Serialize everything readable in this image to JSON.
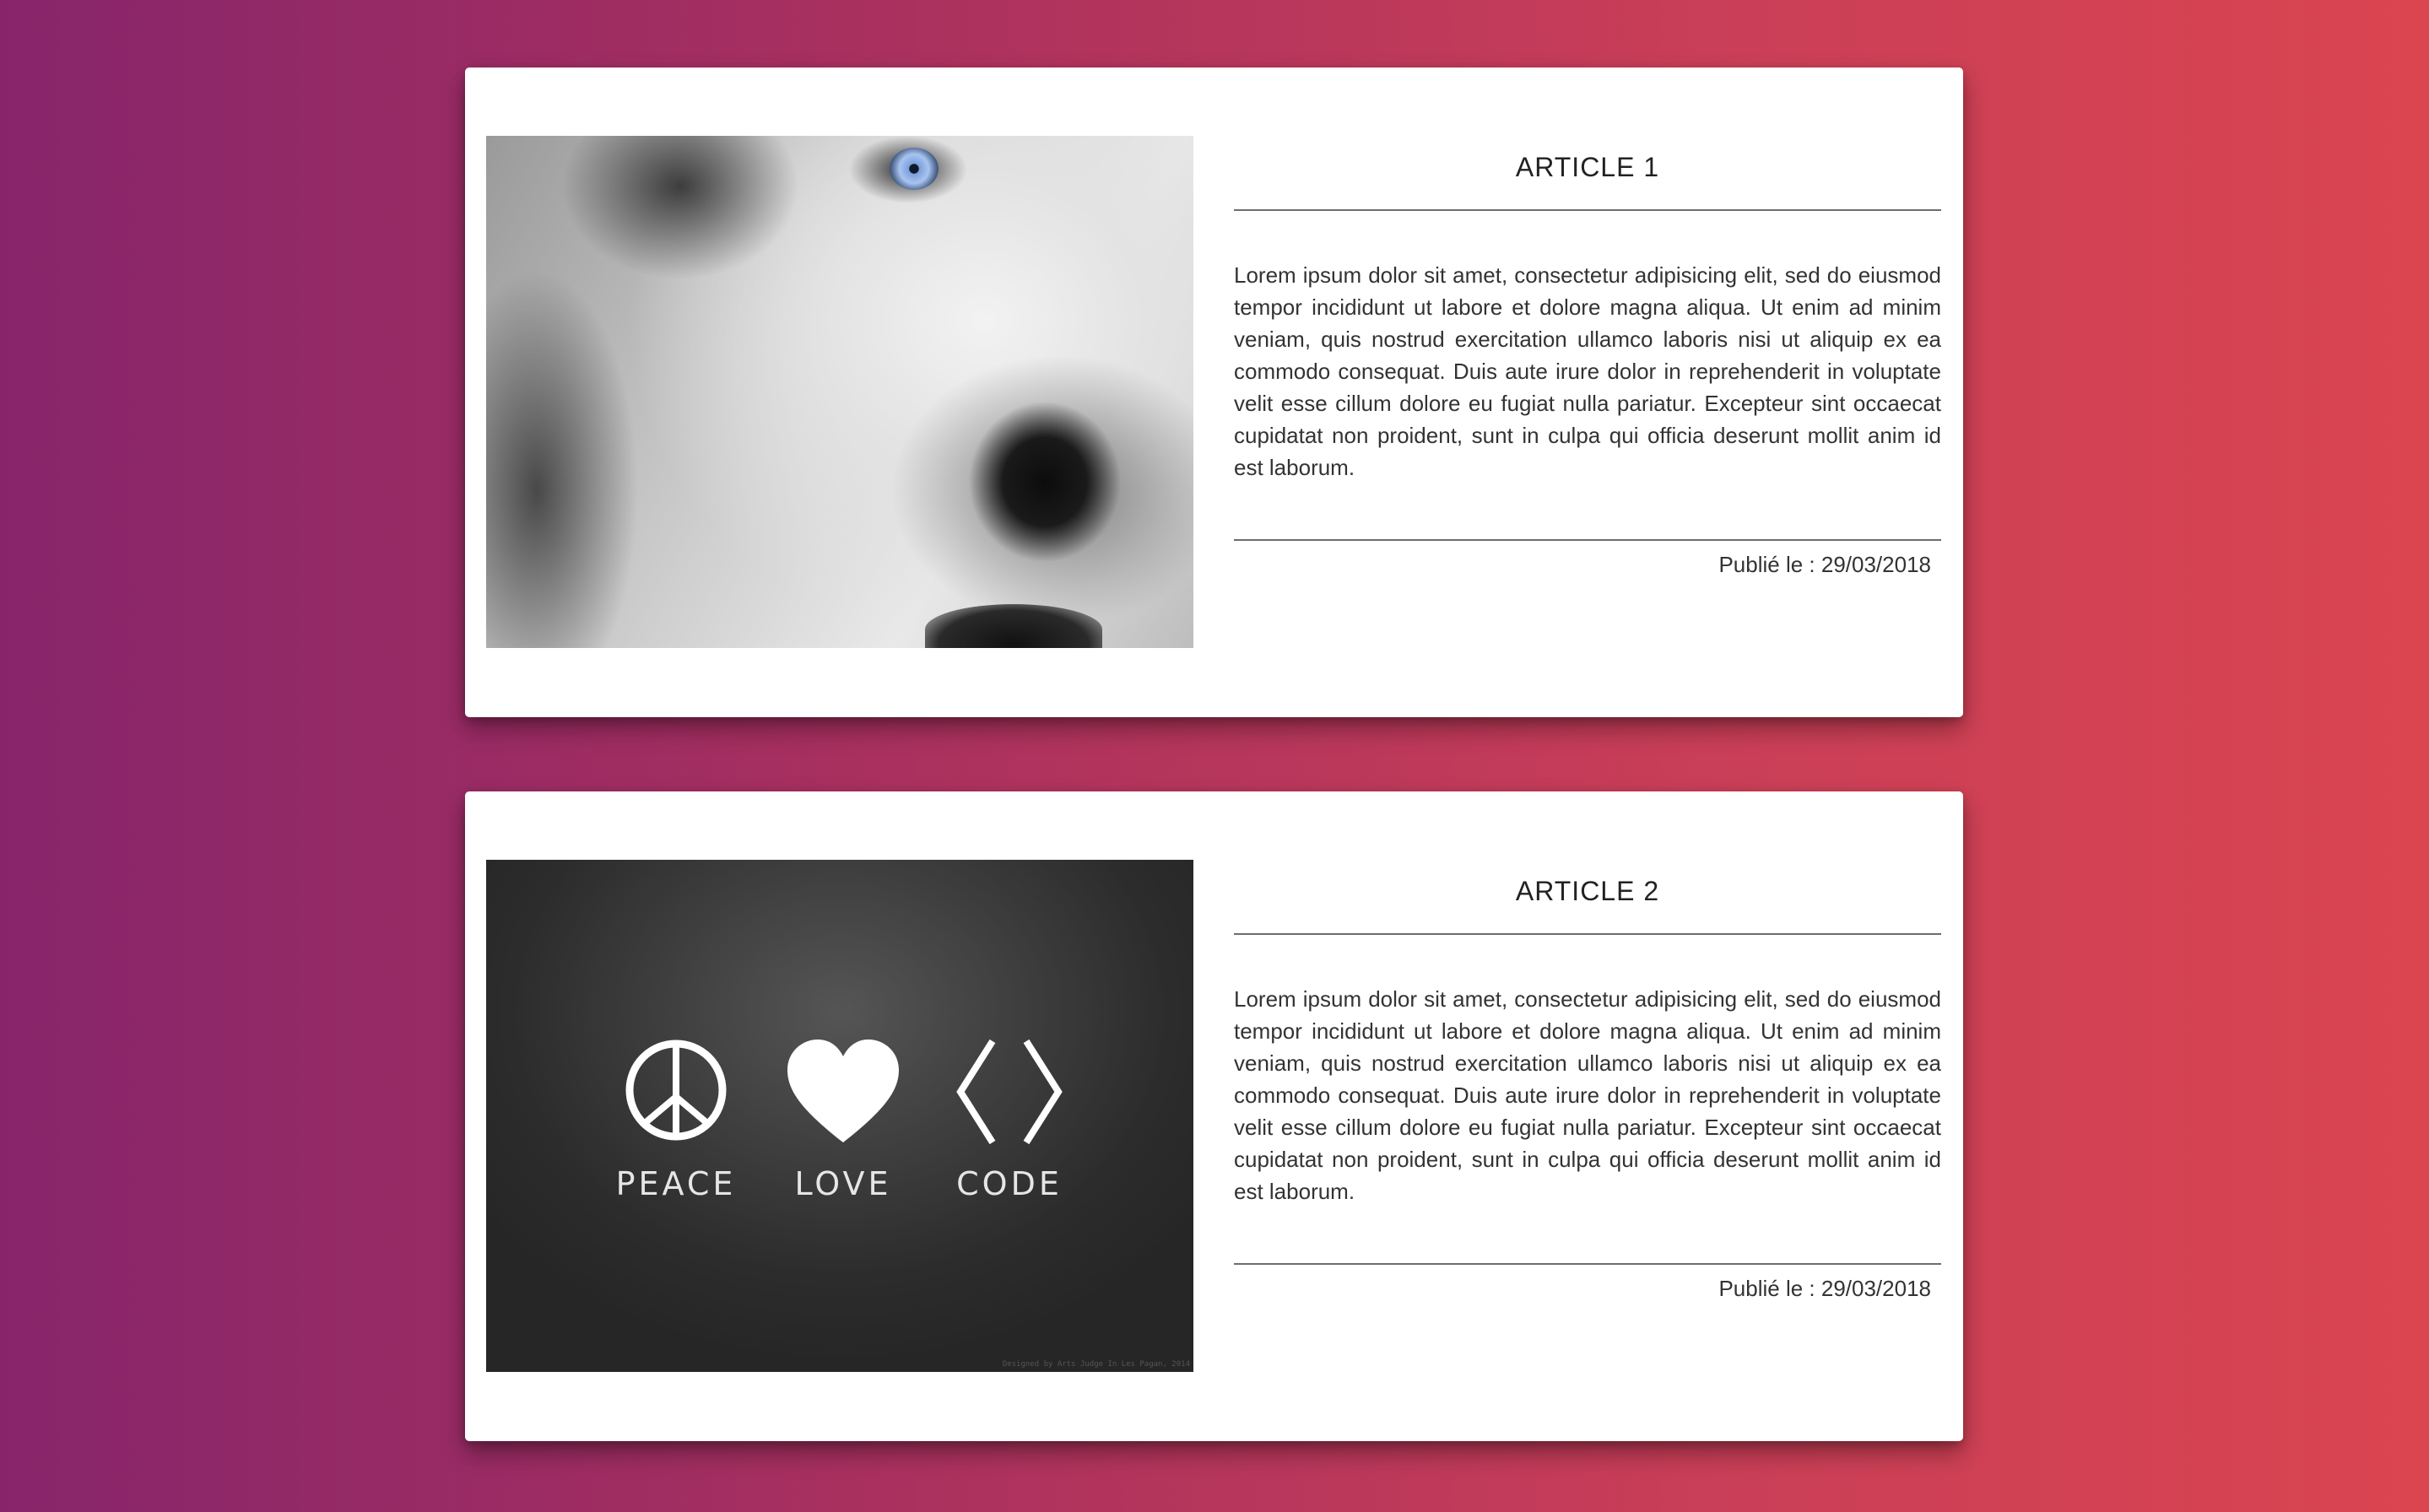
{
  "articles": [
    {
      "title": "ARTICLE 1",
      "image": "husky-wolf-closeup-photo",
      "body": "Lorem ipsum dolor sit amet, consectetur adipisicing elit, sed do eiusmod tempor incididunt ut labore et dolore magna aliqua. Ut enim ad minim veniam, quis nostrud exercitation ullamco laboris nisi ut aliquip ex ea commodo consequat. Duis aute irure dolor in reprehenderit in voluptate velit esse cillum dolore eu fugiat nulla pariatur. Excepteur sint occaecat cupidatat non proident, sunt in culpa qui officia deserunt mollit anim id est laborum.",
      "date": "Publié le : 29/03/2018"
    },
    {
      "title": "ARTICLE 2",
      "image": "peace-love-code-graphic",
      "image_words": [
        "PEACE",
        "LOVE",
        "CODE"
      ],
      "image_credit": "Designed by Arts Judge In Les Pagan, 2014",
      "body": "Lorem ipsum dolor sit amet, consectetur adipisicing elit, sed do eiusmod tempor incididunt ut labore et dolore magna aliqua. Ut enim ad minim veniam, quis nostrud exercitation ullamco laboris nisi ut aliquip ex ea commodo consequat. Duis aute irure dolor in reprehenderit in voluptate velit esse cillum dolore eu fugiat nulla pariatur. Excepteur sint occaecat cupidatat non proident, sunt in culpa qui officia deserunt mollit anim id est laborum.",
      "date": "Publié le : 29/03/2018"
    }
  ],
  "colors": {
    "background_start": "#87256b",
    "background_end": "#da4550",
    "card": "#ffffff",
    "text": "#333333"
  }
}
